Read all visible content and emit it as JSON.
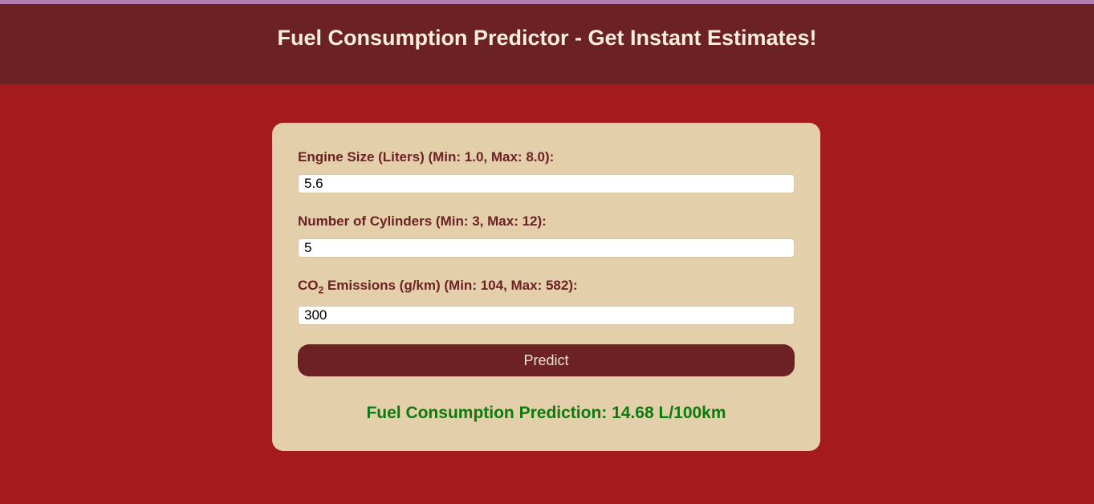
{
  "header": {
    "title": "Fuel Consumption Predictor - Get Instant Estimates!"
  },
  "form": {
    "engine_size": {
      "label": "Engine Size (Liters) (Min: 1.0, Max: 8.0):",
      "value": "5.6"
    },
    "cylinders": {
      "label": "Number of Cylinders (Min: 3, Max: 12):",
      "value": "5"
    },
    "co2": {
      "label_prefix": "CO",
      "label_sub": "2",
      "label_suffix": " Emissions (g/km) (Min: 104, Max: 582):",
      "value": "300"
    },
    "predict_label": "Predict"
  },
  "result": {
    "text": "Fuel Consumption Prediction: 14.68 L/100km"
  },
  "colors": {
    "page_background": "#a51b1d",
    "header_background": "#6c2225",
    "card_background": "#e4cfab",
    "button_background": "#6c2225",
    "result_text": "#0e7a0d",
    "top_strip": "#b07fb2"
  }
}
